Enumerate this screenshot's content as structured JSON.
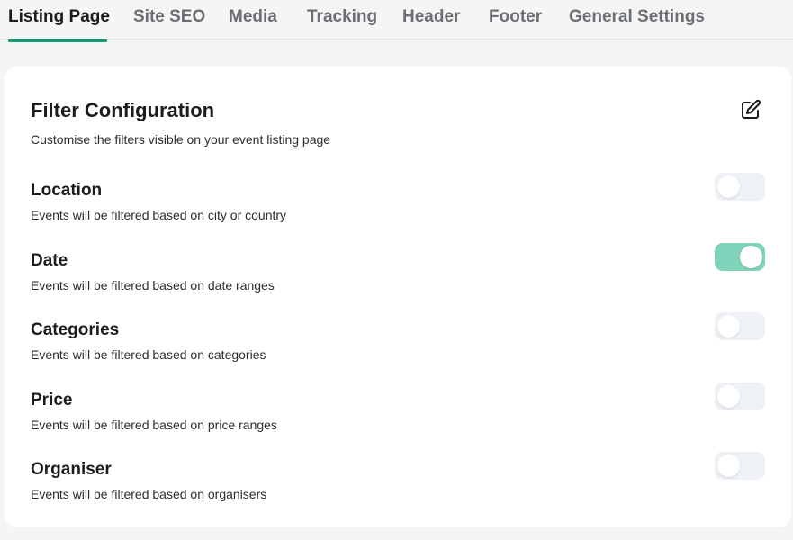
{
  "tabs": [
    {
      "label": "Listing Page",
      "active": true
    },
    {
      "label": "Site SEO",
      "active": false
    },
    {
      "label": "Media",
      "active": false
    },
    {
      "label": "Tracking",
      "active": false
    },
    {
      "label": "Header",
      "active": false
    },
    {
      "label": "Footer",
      "active": false
    },
    {
      "label": "General Settings",
      "active": false
    }
  ],
  "card": {
    "title": "Filter Configuration",
    "subtitle": "Customise the filters visible on your event listing page",
    "edit_icon": "edit-icon"
  },
  "filters": [
    {
      "name": "Location",
      "description": "Events will be filtered based on city or country",
      "enabled": false
    },
    {
      "name": "Date",
      "description": "Events will be filtered based on date ranges",
      "enabled": true
    },
    {
      "name": "Categories",
      "description": "Events will be filtered based on categories",
      "enabled": false
    },
    {
      "name": "Price",
      "description": "Events will be filtered based on price ranges",
      "enabled": false
    },
    {
      "name": "Organiser",
      "description": "Events will be filtered based on organisers",
      "enabled": false
    }
  ],
  "colors": {
    "accent": "#159b77",
    "toggle_on": "#7fd3bb",
    "toggle_off": "#eef1f6"
  }
}
